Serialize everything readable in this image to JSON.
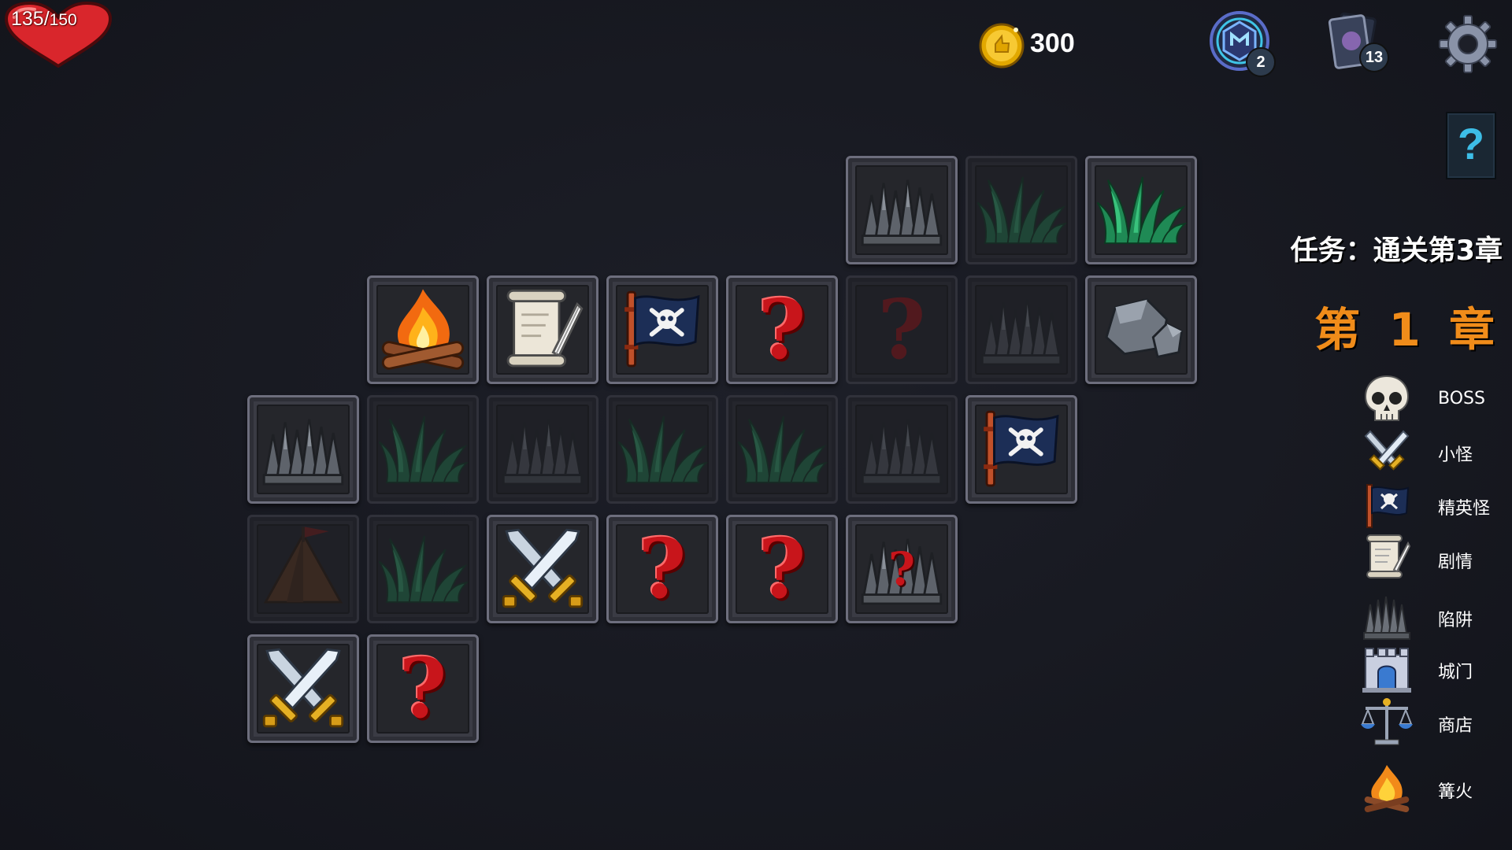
{
  "hud": {
    "hp_current": "135",
    "hp_separator": "/",
    "hp_max": "150",
    "gold": "300",
    "relic_count": "2",
    "deck_count": "13",
    "help_symbol": "?"
  },
  "quest": {
    "text": "任务：通关第3章"
  },
  "chapter": {
    "text": "第 1 章"
  },
  "legend": [
    {
      "icon": "skull-icon",
      "label": "BOSS"
    },
    {
      "icon": "crossed-swords-icon",
      "label": "小怪"
    },
    {
      "icon": "pirate-flag-icon",
      "label": "精英怪"
    },
    {
      "icon": "scroll-icon",
      "label": "剧情"
    },
    {
      "icon": "spikes-icon",
      "label": "陷阱"
    },
    {
      "icon": "castle-gate-icon",
      "label": "城门"
    },
    {
      "icon": "scales-icon",
      "label": "商店"
    },
    {
      "icon": "campfire-icon",
      "label": "篝火"
    }
  ],
  "map": {
    "question_mark": "?",
    "tiles": [
      {
        "row": 0,
        "col": 5,
        "type": "spikes",
        "revealed": true
      },
      {
        "row": 0,
        "col": 6,
        "type": "grass",
        "revealed": false
      },
      {
        "row": 0,
        "col": 7,
        "type": "grass",
        "revealed": true
      },
      {
        "row": 1,
        "col": 1,
        "type": "campfire",
        "revealed": true
      },
      {
        "row": 1,
        "col": 2,
        "type": "scroll",
        "revealed": true
      },
      {
        "row": 1,
        "col": 3,
        "type": "pirate-flag",
        "revealed": true
      },
      {
        "row": 1,
        "col": 4,
        "type": "unknown",
        "revealed": true
      },
      {
        "row": 1,
        "col": 5,
        "type": "unknown",
        "revealed": false
      },
      {
        "row": 1,
        "col": 6,
        "type": "spikes",
        "revealed": false
      },
      {
        "row": 1,
        "col": 7,
        "type": "rocks",
        "revealed": true
      },
      {
        "row": 2,
        "col": 0,
        "type": "spikes",
        "revealed": true
      },
      {
        "row": 2,
        "col": 1,
        "type": "grass",
        "revealed": false
      },
      {
        "row": 2,
        "col": 2,
        "type": "spikes",
        "revealed": false
      },
      {
        "row": 2,
        "col": 3,
        "type": "grass",
        "revealed": false
      },
      {
        "row": 2,
        "col": 4,
        "type": "grass",
        "revealed": false
      },
      {
        "row": 2,
        "col": 5,
        "type": "spikes",
        "revealed": false
      },
      {
        "row": 2,
        "col": 6,
        "type": "pirate-flag",
        "revealed": true
      },
      {
        "row": 3,
        "col": 0,
        "type": "tent",
        "revealed": false
      },
      {
        "row": 3,
        "col": 1,
        "type": "grass",
        "revealed": false
      },
      {
        "row": 3,
        "col": 2,
        "type": "crossed-swords",
        "revealed": true
      },
      {
        "row": 3,
        "col": 3,
        "type": "unknown",
        "revealed": true
      },
      {
        "row": 3,
        "col": 4,
        "type": "unknown",
        "revealed": true
      },
      {
        "row": 3,
        "col": 5,
        "type": "spikes-unknown",
        "revealed": true
      },
      {
        "row": 4,
        "col": 0,
        "type": "crossed-swords",
        "revealed": true
      },
      {
        "row": 4,
        "col": 1,
        "type": "unknown",
        "revealed": true
      }
    ]
  },
  "colors": {
    "background": "#1d1f28",
    "chapter_orange": "#f08c1a",
    "question_red": "#c8151b",
    "help_cyan": "#3dbde6"
  }
}
